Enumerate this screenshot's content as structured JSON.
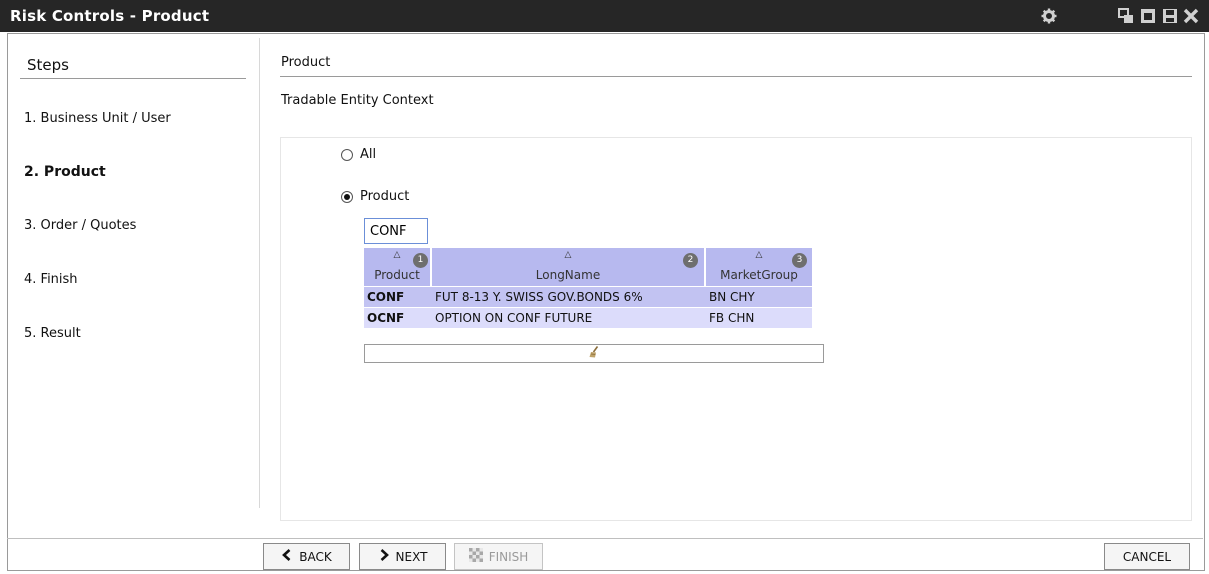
{
  "window": {
    "title": "Risk Controls - Product",
    "controls": [
      "gear-icon",
      "restore-icon",
      "maximize-icon",
      "save-icon",
      "close-icon"
    ]
  },
  "steps": {
    "heading": "Steps",
    "items": [
      {
        "label": "1. Business Unit / User",
        "active": false
      },
      {
        "label": "2. Product",
        "active": true
      },
      {
        "label": "3. Order / Quotes",
        "active": false
      },
      {
        "label": "4. Finish",
        "active": false
      },
      {
        "label": "5. Result",
        "active": false
      }
    ]
  },
  "main": {
    "section_title": "Product",
    "context_title": "Tradable Entity Context",
    "options": [
      {
        "label": "All",
        "checked": false
      },
      {
        "label": "Product",
        "checked": true
      }
    ],
    "filter": {
      "value": "CONF"
    },
    "grid": {
      "columns": [
        {
          "label": "Product",
          "sort_order": "1"
        },
        {
          "label": "LongName",
          "sort_order": "2"
        },
        {
          "label": "MarketGroup",
          "sort_order": "3"
        }
      ],
      "rows": [
        [
          "CONF",
          "FUT 8-13 Y. SWISS GOV.BONDS 6%",
          "BN CHY"
        ],
        [
          "OCNF",
          "OPTION ON CONF FUTURE",
          "FB CHN"
        ]
      ]
    }
  },
  "footer": {
    "back_label": "BACK",
    "next_label": "NEXT",
    "finish_label": "FINISH",
    "cancel_label": "CANCEL"
  },
  "colors": {
    "titlebar": "#262626",
    "grid_header": "#b7b9ef",
    "grid_row_selected": "#c2c3f2",
    "grid_row": "#dcdcfb"
  }
}
